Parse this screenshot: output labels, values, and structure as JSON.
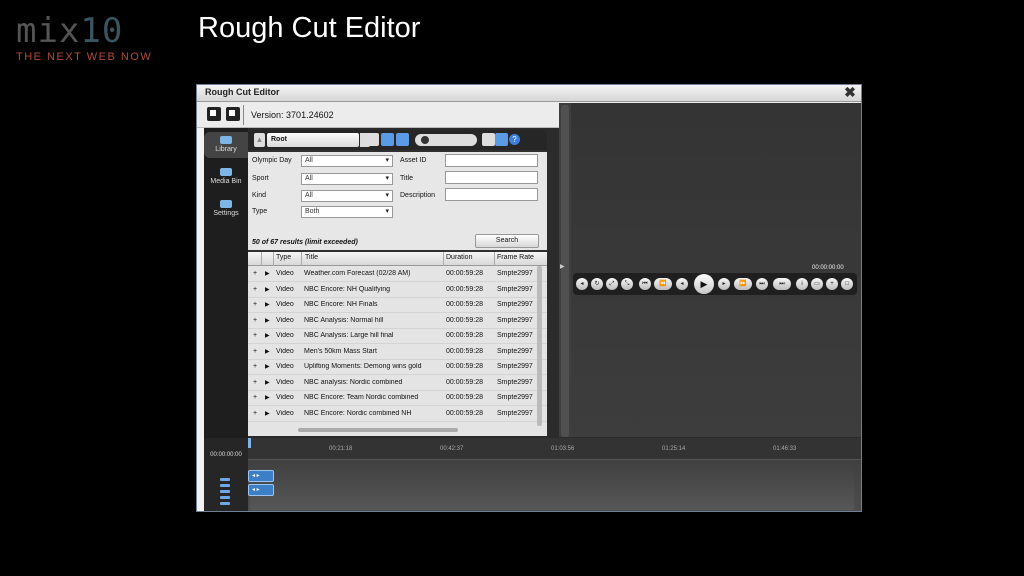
{
  "slide": {
    "logo_mark_a": "mix",
    "logo_mark_b": "10",
    "logo_tagline": "THE NEXT WEB NOW",
    "title": "Rough Cut Editor"
  },
  "window": {
    "title": "Rough Cut Editor",
    "close_glyph": "✖",
    "version_label": "Version:",
    "version_value": "3701.24602"
  },
  "nav": [
    {
      "label": "Library",
      "icon": "library-icon"
    },
    {
      "label": "Media Bin",
      "icon": "media-bin-icon"
    },
    {
      "label": "Settings",
      "icon": "settings-icon"
    }
  ],
  "library": {
    "path": "Root",
    "help_glyph": "?",
    "filters": {
      "olympic_day": {
        "label": "Olympic Day",
        "value": "All"
      },
      "sport": {
        "label": "Sport",
        "value": "All"
      },
      "kind": {
        "label": "Kind",
        "value": "All"
      },
      "type": {
        "label": "Type",
        "value": "Both"
      },
      "asset_id": {
        "label": "Asset ID",
        "value": ""
      },
      "title": {
        "label": "Title",
        "value": ""
      },
      "description": {
        "label": "Description",
        "value": ""
      }
    },
    "results_text": "50 of 67 results (limit exceeded)",
    "search_button": "Search",
    "columns": {
      "type": "Type",
      "title": "Title",
      "duration": "Duration",
      "frame_rate": "Frame Rate"
    },
    "rows": [
      {
        "add": "+",
        "exp": "▶",
        "type": "Video",
        "title": "Weather.com Forecast (02/28 AM)",
        "duration": "00:00:59:28",
        "frame_rate": "Smpte2997"
      },
      {
        "add": "+",
        "exp": "▶",
        "type": "Video",
        "title": "NBC Encore: NH Qualifying",
        "duration": "00:00:59:28",
        "frame_rate": "Smpte2997"
      },
      {
        "add": "+",
        "exp": "▶",
        "type": "Video",
        "title": "NBC Encore: NH Finals",
        "duration": "00:00:59:28",
        "frame_rate": "Smpte2997"
      },
      {
        "add": "+",
        "exp": "▶",
        "type": "Video",
        "title": "NBC Analysis: Normal hill",
        "duration": "00:00:59:28",
        "frame_rate": "Smpte2997"
      },
      {
        "add": "+",
        "exp": "▶",
        "type": "Video",
        "title": "NBC Analysis: Large hill final",
        "duration": "00:00:59:28",
        "frame_rate": "Smpte2997"
      },
      {
        "add": "+",
        "exp": "▶",
        "type": "Video",
        "title": "Men's 50km Mass Start",
        "duration": "00:00:59:28",
        "frame_rate": "Smpte2997"
      },
      {
        "add": "+",
        "exp": "▶",
        "type": "Video",
        "title": "Uplifting Moments: Demong wins gold",
        "duration": "00:00:59:28",
        "frame_rate": "Smpte2997"
      },
      {
        "add": "+",
        "exp": "▶",
        "type": "Video",
        "title": "NBC analysis: Nordic combined",
        "duration": "00:00:59:28",
        "frame_rate": "Smpte2997"
      },
      {
        "add": "+",
        "exp": "▶",
        "type": "Video",
        "title": "NBC Encore: Team Nordic combined",
        "duration": "00:00:59:28",
        "frame_rate": "Smpte2997"
      },
      {
        "add": "+",
        "exp": "▶",
        "type": "Video",
        "title": "NBC Encore: Nordic combined NH",
        "duration": "00:00:59:28",
        "frame_rate": "Smpte2997"
      }
    ]
  },
  "player": {
    "timecode": "00:00:00:00",
    "play_glyph": "▶"
  },
  "timeline": {
    "current_time": "00:00:00:00",
    "ticks": [
      "00:21:18",
      "00:42:37",
      "01:03:56",
      "01:25:14",
      "01:46:33"
    ],
    "track_glyph": "◂ ▸"
  },
  "colors": {
    "accent": "#5b9be6",
    "logo_tagline": "#b04a3a",
    "window_border": "#6f7f95"
  }
}
